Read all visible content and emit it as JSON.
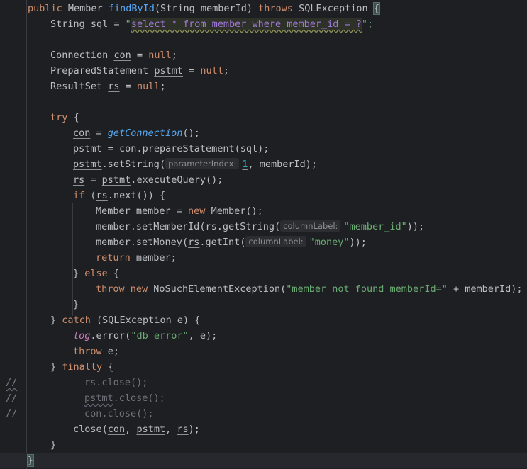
{
  "code": {
    "l1": {
      "kw_public": "public",
      "ret_type": " Member ",
      "method_name": "findById",
      "params": "(String memberId) ",
      "kw_throws": "throws",
      "exc": " SQLException ",
      "brace": "{"
    },
    "l2": {
      "decl": "String sql = ",
      "sql_open_quote": "\"",
      "sql_text": "select * from member where member_id = ?",
      "sql_close": "\";"
    },
    "l4": {
      "type": "Connection ",
      "var": "con",
      "eq": " = ",
      "null_kw": "null",
      "end": ";"
    },
    "l5": {
      "type": "PreparedStatement ",
      "var": "pstmt",
      "eq": " = ",
      "null_kw": "null",
      "end": ";"
    },
    "l6": {
      "type": "ResultSet ",
      "var": "rs",
      "eq": " = ",
      "null_kw": "null",
      "end": ";"
    },
    "l8": {
      "kw_try": "try",
      "rest": " {"
    },
    "l9": {
      "var": "con",
      "eq": " = ",
      "call": "getConnection",
      "end": "();"
    },
    "l10": {
      "var": "pstmt",
      "eq": " = ",
      "obj": "con",
      "dot": ".",
      "call": "prepareStatement",
      "end": "(sql);"
    },
    "l11": {
      "var": "pstmt",
      "dot": ".",
      "call": "setString",
      "open": "(",
      "hint": "parameterIndex:",
      "num": "1",
      "end": ", memberId);"
    },
    "l12": {
      "var": "rs",
      "eq": " = ",
      "obj": "pstmt",
      "dot": ".",
      "call": "executeQuery",
      "end": "();"
    },
    "l13": {
      "kw_if": "if",
      "open": " (",
      "obj": "rs",
      "dot": ".",
      "call": "next",
      "end": "()) {"
    },
    "l14": {
      "pre": "Member member = ",
      "kw_new": "new",
      "post": " Member();"
    },
    "l15": {
      "pre": "member.",
      "call": "setMemberId",
      "open": "(",
      "obj": "rs",
      "dot": ".",
      "call2": "getString",
      "open2": "(",
      "hint": "columnLabel:",
      "str": "\"member_id\"",
      "end": "));"
    },
    "l16": {
      "pre": "member.",
      "call": "setMoney",
      "open": "(",
      "obj": "rs",
      "dot": ".",
      "call2": "getInt",
      "open2": "(",
      "hint": "columnLabel:",
      "str": "\"money\"",
      "end": "));"
    },
    "l17": {
      "kw_return": "return",
      "rest": " member;"
    },
    "l18": {
      "pre": "} ",
      "kw_else": "else",
      "post": " {"
    },
    "l19": {
      "kw_throw": "throw",
      "sp": " ",
      "kw_new": "new",
      "cls": " NoSuchElementException(",
      "str": "\"member not found memberId=\"",
      "end": " + memberId);"
    },
    "l20": {
      "text": "}"
    },
    "l21": {
      "pre": "} ",
      "kw_catch": "catch",
      "post": " (SQLException e) {"
    },
    "l22": {
      "field": "log",
      "dot": ".",
      "call": "error",
      "open": "(",
      "str": "\"db error\"",
      "end": ", e);"
    },
    "l23": {
      "kw_throw": "throw",
      "rest": " e;"
    },
    "l24": {
      "pre": "} ",
      "kw_finally": "finally",
      "post": " {"
    },
    "l25": {
      "marker": "//",
      "text": "rs.close();"
    },
    "l26": {
      "marker": "//",
      "var": "pstmt",
      "text": ".close();"
    },
    "l27": {
      "marker": "//",
      "text": "con.close();"
    },
    "l28": {
      "call": "close",
      "open": "(",
      "a1": "con",
      "c1": ", ",
      "a2": "pstmt",
      "c2": ", ",
      "a3": "rs",
      "end": ");"
    },
    "l29": {
      "text": "}"
    },
    "l30": {
      "text": "}"
    }
  }
}
